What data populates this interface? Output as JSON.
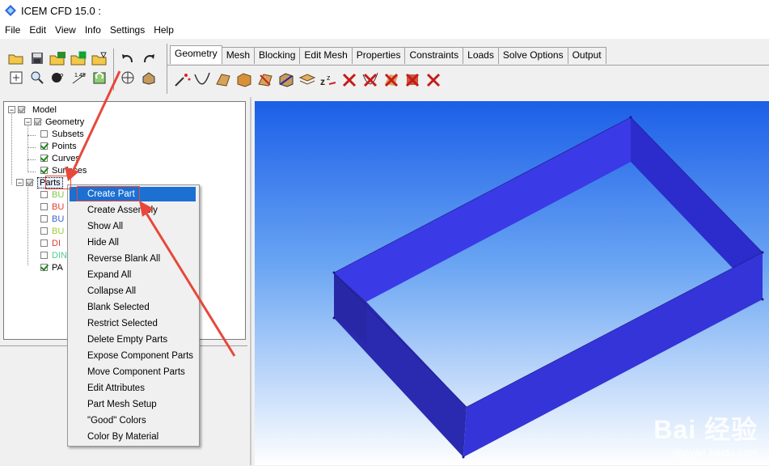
{
  "window": {
    "title": "ICEM CFD 15.0 :"
  },
  "menu": [
    "File",
    "Edit",
    "View",
    "Info",
    "Settings",
    "Help"
  ],
  "tabs": [
    "Geometry",
    "Mesh",
    "Blocking",
    "Edit Mesh",
    "Properties",
    "Constraints",
    "Loads",
    "Solve Options",
    "Output"
  ],
  "tree": {
    "model": "Model",
    "geometry": "Geometry",
    "subsets": "Subsets",
    "points": "Points",
    "curves": "Curves",
    "surfaces": "Surfaces",
    "parts": "Parts",
    "part_items": [
      {
        "label": "BU",
        "color": "#7ac943"
      },
      {
        "label": "BU",
        "color": "#e03c31"
      },
      {
        "label": "BU",
        "color": "#3a5fcd"
      },
      {
        "label": "BU",
        "color": "#9acd32"
      },
      {
        "label": "DI",
        "color": "#e03c31"
      },
      {
        "label": "DIN",
        "color": "#4bd18a"
      },
      {
        "label": "PA",
        "color": "#000000"
      }
    ]
  },
  "context_menu": {
    "items": [
      "Create Part",
      "Create Assembly",
      "Show All",
      "Hide All",
      "Reverse Blank All",
      "Expand All",
      "Collapse All",
      "Blank Selected",
      "Restrict Selected",
      "Delete Empty Parts",
      "Expose Component Parts",
      "Move Component Parts",
      "Edit Attributes",
      "Part Mesh Setup",
      "\"Good\" Colors",
      "Color By Material"
    ],
    "highlighted": "Create Part"
  },
  "watermark": {
    "big": "Bai 经验",
    "small": "jingyan.baidu.com"
  },
  "colors": {
    "model_fill": "#3a3ae6",
    "model_dark": "#2a2ab0",
    "highlight": "#1b70d2",
    "annotation": "#e8473b"
  }
}
